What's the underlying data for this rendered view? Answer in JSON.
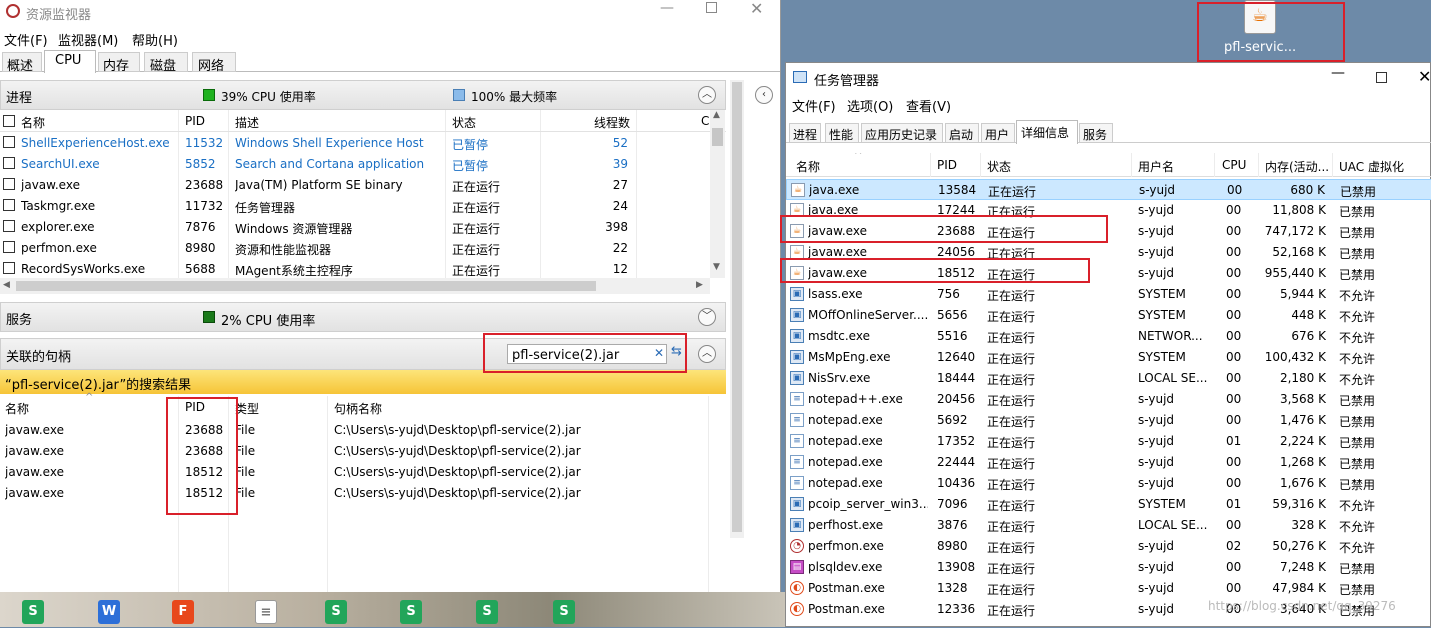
{
  "resmon": {
    "title": "资源监视器",
    "menu": [
      "文件(F)",
      "监视器(M)",
      "帮助(H)"
    ],
    "tabs": [
      "概述",
      "CPU",
      "内存",
      "磁盘",
      "网络"
    ],
    "processes": {
      "title": "进程",
      "cpu": "39% CPU 使用率",
      "freq": "100% 最大频率",
      "columns": [
        "名称",
        "PID",
        "描述",
        "状态",
        "线程数",
        "C"
      ],
      "rows": [
        {
          "name": "ShellExperienceHost.exe",
          "pid": "11532",
          "desc": "Windows Shell Experience Host",
          "status": "已暂停",
          "threads": "52",
          "hl": true
        },
        {
          "name": "SearchUI.exe",
          "pid": "5852",
          "desc": "Search and Cortana application",
          "status": "已暂停",
          "threads": "39",
          "hl": true
        },
        {
          "name": "javaw.exe",
          "pid": "23688",
          "desc": "Java(TM) Platform SE binary",
          "status": "正在运行",
          "threads": "27"
        },
        {
          "name": "Taskmgr.exe",
          "pid": "11732",
          "desc": "任务管理器",
          "status": "正在运行",
          "threads": "24"
        },
        {
          "name": "explorer.exe",
          "pid": "7876",
          "desc": "Windows 资源管理器",
          "status": "正在运行",
          "threads": "398"
        },
        {
          "name": "perfmon.exe",
          "pid": "8980",
          "desc": "资源和性能监视器",
          "status": "正在运行",
          "threads": "22"
        },
        {
          "name": "RecordSysWorks.exe",
          "pid": "5688",
          "desc": "MAgent系统主控程序",
          "status": "正在运行",
          "threads": "12"
        }
      ]
    },
    "services": {
      "title": "服务",
      "cpu": "2% CPU 使用率"
    },
    "handles": {
      "title": "关联的句柄",
      "search": "pfl-service(2).jar",
      "result": "“pfl-service(2).jar”的搜索结果",
      "columns": [
        "名称",
        "PID",
        "类型",
        "句柄名称"
      ],
      "rows": [
        {
          "name": "javaw.exe",
          "pid": "23688",
          "type": "File",
          "handle": "C:\\Users\\s-yujd\\Desktop\\pfl-service(2).jar"
        },
        {
          "name": "javaw.exe",
          "pid": "23688",
          "type": "File",
          "handle": "C:\\Users\\s-yujd\\Desktop\\pfl-service(2).jar"
        },
        {
          "name": "javaw.exe",
          "pid": "18512",
          "type": "File",
          "handle": "C:\\Users\\s-yujd\\Desktop\\pfl-service(2).jar"
        },
        {
          "name": "javaw.exe",
          "pid": "18512",
          "type": "File",
          "handle": "C:\\Users\\s-yujd\\Desktop\\pfl-service(2).jar"
        }
      ]
    }
  },
  "desktop": {
    "icon_label": "pfl-servic..."
  },
  "taskmgr": {
    "title": "任务管理器",
    "menu": [
      "文件(F)",
      "选项(O)",
      "查看(V)"
    ],
    "tabs": [
      "进程",
      "性能",
      "应用历史记录",
      "启动",
      "用户",
      "详细信息",
      "服务"
    ],
    "columns": [
      "名称",
      "PID",
      "状态",
      "用户名",
      "CPU",
      "内存(活动...",
      "UAC 虚拟化"
    ],
    "rows": [
      {
        "name": "java.exe",
        "pid": "13584",
        "status": "正在运行",
        "user": "s-yujd",
        "cpu": "00",
        "mem": "680 K",
        "uac": "已禁用",
        "icon": "java",
        "sel": true
      },
      {
        "name": "java.exe",
        "pid": "17244",
        "status": "正在运行",
        "user": "s-yujd",
        "cpu": "00",
        "mem": "11,808 K",
        "uac": "已禁用",
        "icon": "java"
      },
      {
        "name": "javaw.exe",
        "pid": "23688",
        "status": "正在运行",
        "user": "s-yujd",
        "cpu": "00",
        "mem": "747,172 K",
        "uac": "已禁用",
        "icon": "java"
      },
      {
        "name": "javaw.exe",
        "pid": "24056",
        "status": "正在运行",
        "user": "s-yujd",
        "cpu": "00",
        "mem": "52,168 K",
        "uac": "已禁用",
        "icon": "java"
      },
      {
        "name": "javaw.exe",
        "pid": "18512",
        "status": "正在运行",
        "user": "s-yujd",
        "cpu": "00",
        "mem": "955,440 K",
        "uac": "已禁用",
        "icon": "java"
      },
      {
        "name": "lsass.exe",
        "pid": "756",
        "status": "正在运行",
        "user": "SYSTEM",
        "cpu": "00",
        "mem": "5,944 K",
        "uac": "不允许",
        "icon": "win"
      },
      {
        "name": "MOffOnlineServer....",
        "pid": "5656",
        "status": "正在运行",
        "user": "SYSTEM",
        "cpu": "00",
        "mem": "448 K",
        "uac": "不允许",
        "icon": "win"
      },
      {
        "name": "msdtc.exe",
        "pid": "5516",
        "status": "正在运行",
        "user": "NETWOR...",
        "cpu": "00",
        "mem": "676 K",
        "uac": "不允许",
        "icon": "win"
      },
      {
        "name": "MsMpEng.exe",
        "pid": "12640",
        "status": "正在运行",
        "user": "SYSTEM",
        "cpu": "00",
        "mem": "100,432 K",
        "uac": "不允许",
        "icon": "win"
      },
      {
        "name": "NisSrv.exe",
        "pid": "18444",
        "status": "正在运行",
        "user": "LOCAL SE...",
        "cpu": "00",
        "mem": "2,180 K",
        "uac": "不允许",
        "icon": "win"
      },
      {
        "name": "notepad++.exe",
        "pid": "20456",
        "status": "正在运行",
        "user": "s-yujd",
        "cpu": "00",
        "mem": "3,568 K",
        "uac": "已禁用",
        "icon": "note"
      },
      {
        "name": "notepad.exe",
        "pid": "5692",
        "status": "正在运行",
        "user": "s-yujd",
        "cpu": "00",
        "mem": "1,476 K",
        "uac": "已禁用",
        "icon": "note"
      },
      {
        "name": "notepad.exe",
        "pid": "17352",
        "status": "正在运行",
        "user": "s-yujd",
        "cpu": "01",
        "mem": "2,224 K",
        "uac": "已禁用",
        "icon": "note"
      },
      {
        "name": "notepad.exe",
        "pid": "22444",
        "status": "正在运行",
        "user": "s-yujd",
        "cpu": "00",
        "mem": "1,268 K",
        "uac": "已禁用",
        "icon": "note"
      },
      {
        "name": "notepad.exe",
        "pid": "10436",
        "status": "正在运行",
        "user": "s-yujd",
        "cpu": "00",
        "mem": "1,676 K",
        "uac": "已禁用",
        "icon": "note"
      },
      {
        "name": "pcoip_server_win3...",
        "pid": "7096",
        "status": "正在运行",
        "user": "SYSTEM",
        "cpu": "01",
        "mem": "59,316 K",
        "uac": "不允许",
        "icon": "win"
      },
      {
        "name": "perfhost.exe",
        "pid": "3876",
        "status": "正在运行",
        "user": "LOCAL SE...",
        "cpu": "00",
        "mem": "328 K",
        "uac": "不允许",
        "icon": "win"
      },
      {
        "name": "perfmon.exe",
        "pid": "8980",
        "status": "正在运行",
        "user": "s-yujd",
        "cpu": "02",
        "mem": "50,276 K",
        "uac": "不允许",
        "icon": "perf"
      },
      {
        "name": "plsqldev.exe",
        "pid": "13908",
        "status": "正在运行",
        "user": "s-yujd",
        "cpu": "00",
        "mem": "7,248 K",
        "uac": "已禁用",
        "icon": "db"
      },
      {
        "name": "Postman.exe",
        "pid": "1328",
        "status": "正在运行",
        "user": "s-yujd",
        "cpu": "00",
        "mem": "47,984 K",
        "uac": "已禁用",
        "icon": "postman"
      },
      {
        "name": "Postman.exe",
        "pid": "12336",
        "status": "正在运行",
        "user": "s-yujd",
        "cpu": "00",
        "mem": "3,640 K",
        "uac": "已禁用",
        "icon": "postman"
      }
    ]
  },
  "watermark": "https://blog.csdn.net/qq_39276",
  "taskbar_icons": [
    "S",
    "W",
    "F",
    "doc",
    "S",
    "S",
    "S",
    "S"
  ]
}
